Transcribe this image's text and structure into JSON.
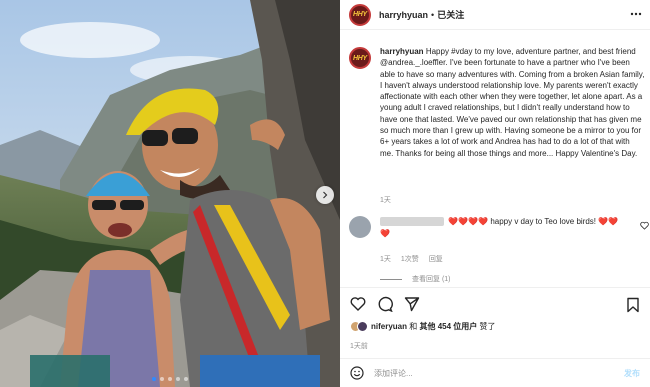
{
  "post": {
    "username": "harryhyuan",
    "separator": "•",
    "follow_status": "已关注",
    "avatar_text": "HHY"
  },
  "caption": {
    "username": "harryhyuan",
    "text": "Happy #vday to my love, adventure partner, and best friend @andrea._.loeffler. I've been fortunate to have a partner who I've been able to have so many adventures with. Coming from a broken Asian family, I haven't always understood relationship love. My parents weren't exactly affectionate with each other when they were together, let alone apart. As a young adult I craved relationships, but I didn't really understand how to have one that lasted. We've paved our own relationship that has given me so much more than I grew up with. Having someone be a mirror to you for 6+ years takes a lot of work and Andrea has had to do a lot of that with me. Thanks for being all those things and more... Happy Valentine's Day.",
    "time": "1天"
  },
  "comment": {
    "hearts_lead": "❤️❤️❤️❤️",
    "text": "happy v day to Teo love birds! ❤️❤️❤️",
    "time": "1天",
    "likes": "1次赞",
    "reply": "回复",
    "view_replies": "查看回复 (1)"
  },
  "likes": {
    "user": "niferyuan",
    "conj": "和",
    "others": "其他 454 位用户",
    "suffix": "赞了"
  },
  "post_time": "1天前",
  "add_comment": {
    "placeholder": "添加评论...",
    "send": "发布"
  },
  "icons": {
    "more": "more-icon",
    "next": "chevron-right-icon",
    "like": "heart-icon",
    "comment": "comment-icon",
    "share": "send-icon",
    "save": "bookmark-icon",
    "emoji": "emoji-icon"
  },
  "carousel": {
    "count": 5,
    "active": 1
  },
  "colors": {
    "accent": "#2f8bff",
    "heart": "#e0245e",
    "muted": "#8e8e8e"
  }
}
